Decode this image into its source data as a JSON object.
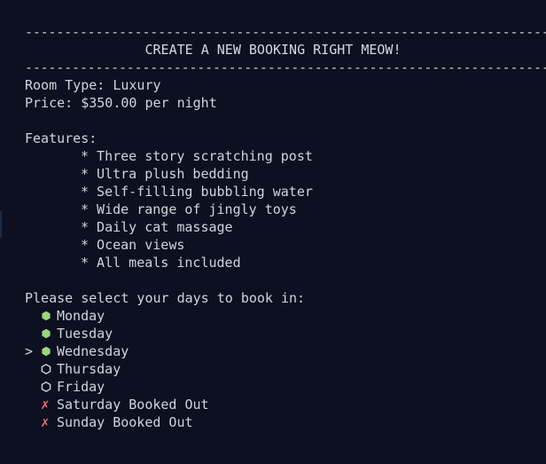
{
  "header": {
    "rule_top": "----------------------------------------------------------------------",
    "title": "CREATE A NEW BOOKING RIGHT MEOW!",
    "rule_bottom": "----------------------------------------------------------------------"
  },
  "room": {
    "type_line": "Room Type: Luxury",
    "price_line": "Price: $350.00 per night"
  },
  "features": {
    "heading": "Features:",
    "items": [
      "* Three story scratching post",
      "* Ultra plush bedding",
      "* Self-filling bubbling water",
      "* Wide range of jingly toys",
      "* Daily cat massage",
      "* Ocean views",
      "* All meals included"
    ]
  },
  "booking": {
    "prompt": "Please select your days to book in:",
    "cursor_symbol": ">",
    "days": [
      {
        "label": "Monday",
        "state": "selected"
      },
      {
        "label": "Tuesday",
        "state": "selected"
      },
      {
        "label": "Wednesday",
        "state": "selected",
        "cursor": true
      },
      {
        "label": "Thursday",
        "state": "unselected"
      },
      {
        "label": "Friday",
        "state": "unselected"
      },
      {
        "label": "Saturday Booked Out",
        "state": "booked-out"
      },
      {
        "label": "Sunday Booked Out",
        "state": "booked-out"
      }
    ],
    "booked_out_symbol": "✗"
  },
  "colors": {
    "background": "#0c1021",
    "text": "#d0d4de",
    "selected": "#9dd67a",
    "booked_out": "#f06a6a"
  }
}
